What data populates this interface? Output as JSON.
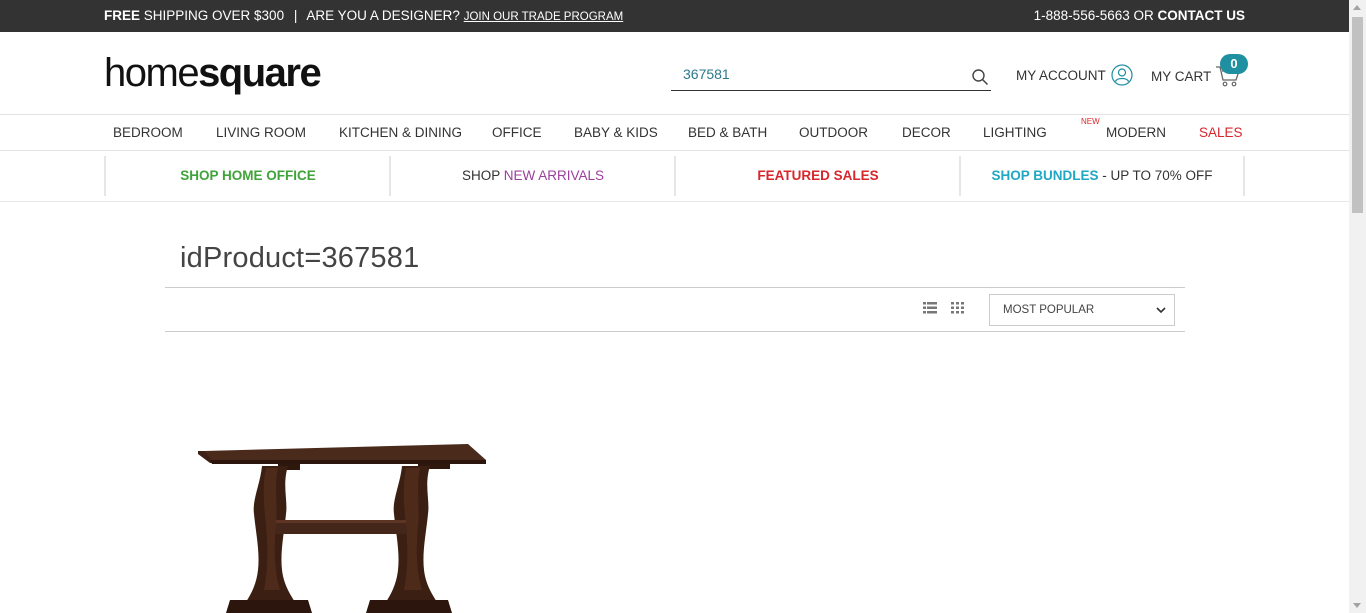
{
  "topbar": {
    "free": "FREE",
    "shipping": " SHIPPING OVER $300",
    "separator": "|",
    "designer": "ARE YOU A DESIGNER?",
    "trade_link": "JOIN OUR TRADE PROGRAM",
    "phone": "1-888-556-5663",
    "or": " OR ",
    "contact": "CONTACT US"
  },
  "header": {
    "logo_light": "home",
    "logo_bold": "square",
    "search_value": "367581",
    "account_label": "MY ACCOUNT",
    "cart_label": "MY CART",
    "cart_count": "0",
    "accent_color": "#1f8fa2"
  },
  "main_nav": {
    "items": [
      {
        "label": "BEDROOM"
      },
      {
        "label": "LIVING ROOM"
      },
      {
        "label": "KITCHEN & DINING"
      },
      {
        "label": "OFFICE"
      },
      {
        "label": "BABY & KIDS"
      },
      {
        "label": "BED & BATH"
      },
      {
        "label": "OUTDOOR"
      },
      {
        "label": "DECOR"
      },
      {
        "label": "LIGHTING"
      },
      {
        "label": "MODERN",
        "badge": "NEW"
      },
      {
        "label": "SALES"
      }
    ]
  },
  "promo": {
    "home_office": "SHOP HOME OFFICE",
    "arrivals_prefix": "SHOP ",
    "arrivals": "NEW ARRIVALS",
    "featured_sales": "FEATURED SALES",
    "bundles": "SHOP BUNDLES",
    "bundles_suffix": " - UP TO 70% OFF"
  },
  "results": {
    "title": "idProduct=367581",
    "sort_selected": "MOST POPULAR",
    "view_icons": [
      "list-view-icon",
      "grid-view-icon"
    ]
  },
  "icons": {
    "search": "search-icon",
    "account": "user-circle-icon",
    "cart": "cart-icon"
  }
}
